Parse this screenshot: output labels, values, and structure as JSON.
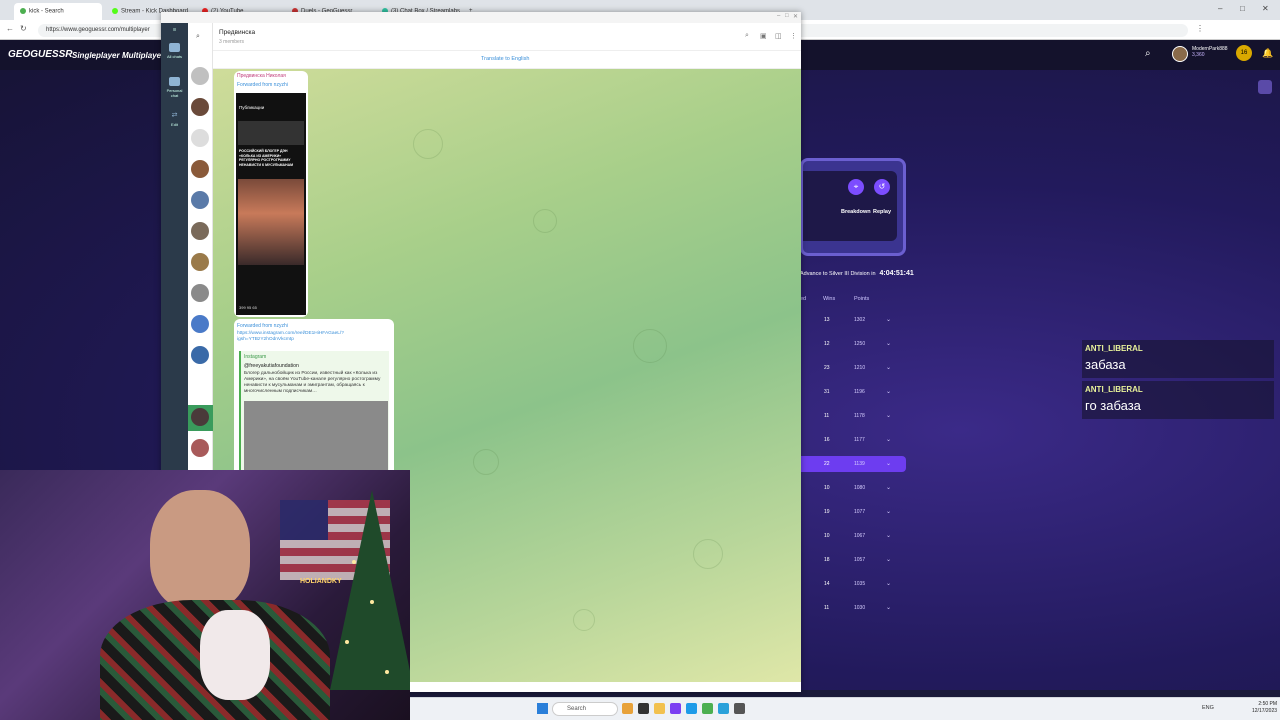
{
  "browser": {
    "tabs": [
      "kick - Search",
      "Stream - Kick Dashboard",
      "(2) YouTube",
      "Duels - GeoGuessr",
      "(3) Chat Box / Streamlabs"
    ],
    "new_tab": "+",
    "url": "https://www.geoguessr.com/multiplayer"
  },
  "geoguessr": {
    "logo": "GEOGUESSR",
    "nav": [
      "Singleplayer",
      "Multiplayer"
    ],
    "user": {
      "name": "ModernPark888",
      "coins": "3,360",
      "level": "16"
    },
    "breakdown_label": "Breakdown",
    "replay_label": "Replay",
    "advance_text": "Advance to Silver III Division in",
    "timer": "4:04:51:41",
    "columns": {
      "rank": "ed",
      "wins": "Wins",
      "points": "Points"
    },
    "leaderboard": [
      {
        "wins": "13",
        "points": "1302"
      },
      {
        "wins": "12",
        "points": "1250"
      },
      {
        "wins": "23",
        "points": "1210"
      },
      {
        "wins": "31",
        "points": "1196"
      },
      {
        "wins": "11",
        "points": "1178"
      },
      {
        "wins": "16",
        "points": "1177"
      },
      {
        "wins": "22",
        "points": "1139"
      },
      {
        "wins": "10",
        "points": "1080"
      },
      {
        "wins": "19",
        "points": "1077"
      },
      {
        "wins": "10",
        "points": "1067"
      },
      {
        "wins": "18",
        "points": "1057"
      },
      {
        "wins": "14",
        "points": "1035"
      },
      {
        "wins": "11",
        "points": "1030"
      }
    ]
  },
  "chat": [
    {
      "user": "ANTI_LIBERAL",
      "text": "забаза"
    },
    {
      "user": "ANTI_LIBERAL",
      "text": "го забаза"
    }
  ],
  "telegram": {
    "title": "Предвинска",
    "subtitle": "3 members",
    "translate": "Translate to English",
    "folders": [
      "All chats",
      "Personal chat",
      "Edit"
    ],
    "msg1": {
      "sender": "Предвинска Николая",
      "forwarded": "Forwarded from nzyzhi",
      "phone_header": "Публикации",
      "caption": "РОССИЙСКИЙ БЛОГЕР ДЭН «КОЛЬКА ИЗ АМЕРИКИ» РЕГУЛЯРНО РОСТРОГРАММУ НЕНАВИСТИ К МУСУЛЬМАНАМ",
      "stats": "399  95  65"
    },
    "msg2": {
      "forwarded": "Forwarded from nzyzhi",
      "link": "https://www.instagram.com/reel/DE1HiHFAGaeL/?igsh=YTBzY2hOdnVkcmtp",
      "site": "Instagram",
      "title": "@freeyakutiafoundation",
      "text": "Блогер дальнобойщик из России, известный как «Колька из Америки», на своём YouTube-канале регулярно ростограмму ненависти к мусульманам и эмигрантам, обращаясь к многочисленным подписчикам…"
    }
  },
  "webcam": {
    "neon": "HOLIANDKY"
  },
  "taskbar": {
    "search": "Search",
    "tray_lang": "ENG",
    "time": "2:50 PM",
    "date": "12/17/2023"
  }
}
